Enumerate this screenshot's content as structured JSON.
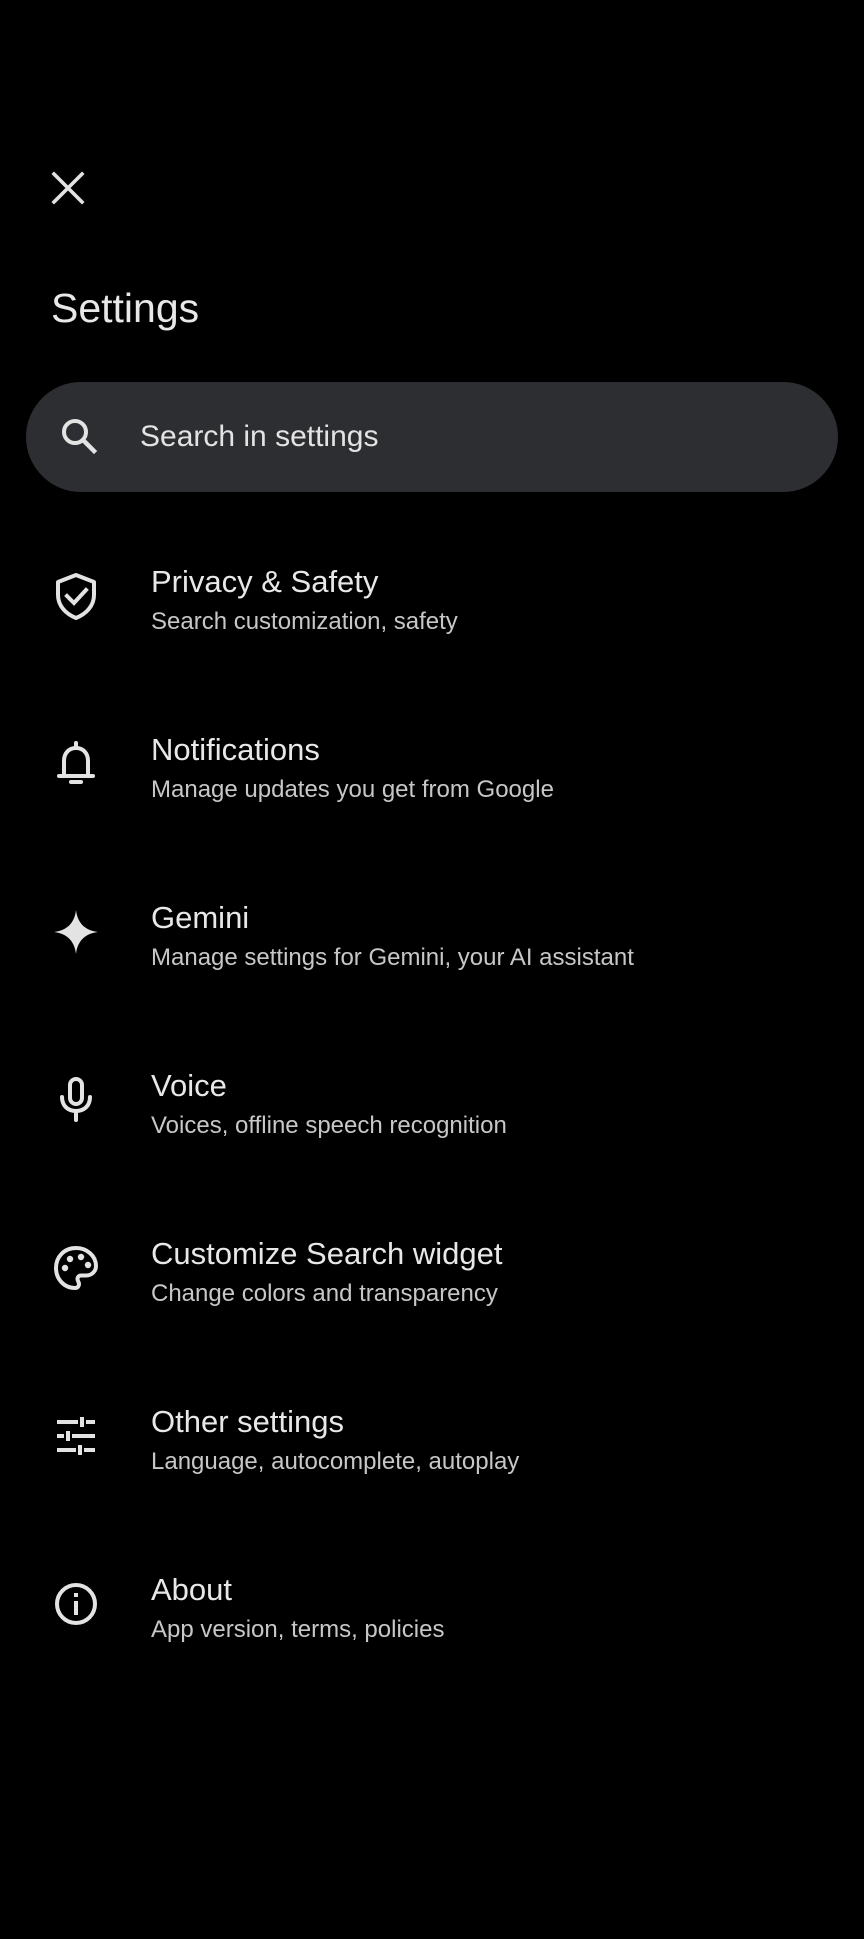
{
  "header": {
    "close_icon": "close-icon",
    "title": "Settings"
  },
  "search": {
    "icon": "search-icon",
    "placeholder": "Search in settings"
  },
  "colors": {
    "background": "#000000",
    "search_bar": "#2d2e31",
    "primary_text": "#e8e8e8",
    "secondary_text": "#c7c7c7",
    "icon": "#e3e3e3"
  },
  "items": [
    {
      "icon": "shield-check-icon",
      "title": "Privacy & Safety",
      "subtitle": "Search customization, safety"
    },
    {
      "icon": "bell-icon",
      "title": "Notifications",
      "subtitle": "Manage updates you get from Google"
    },
    {
      "icon": "sparkle-icon",
      "title": "Gemini",
      "subtitle": "Manage settings for Gemini, your AI assistant"
    },
    {
      "icon": "microphone-icon",
      "title": "Voice",
      "subtitle": "Voices, offline speech recognition"
    },
    {
      "icon": "palette-icon",
      "title": "Customize Search widget",
      "subtitle": "Change colors and transparency"
    },
    {
      "icon": "sliders-icon",
      "title": "Other settings",
      "subtitle": "Language, autocomplete, autoplay"
    },
    {
      "icon": "info-icon",
      "title": "About",
      "subtitle": "App version, terms, policies"
    }
  ]
}
